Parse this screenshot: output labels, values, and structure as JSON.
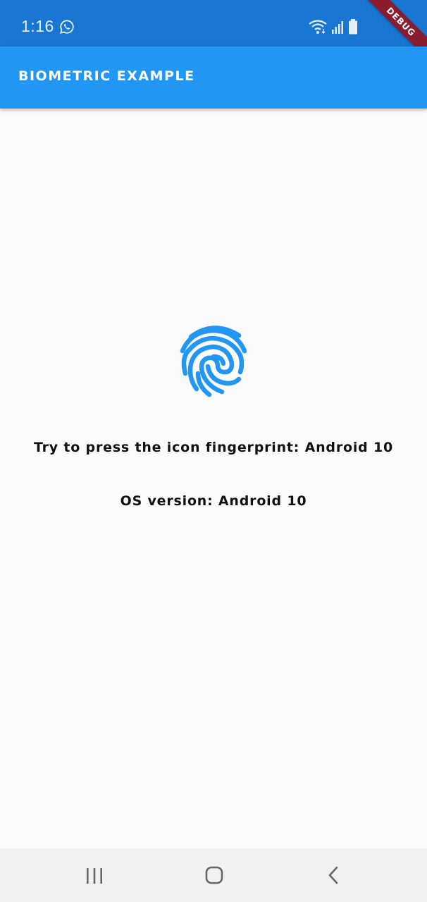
{
  "status_bar": {
    "time": "1:16",
    "icons": [
      "whatsapp-icon",
      "wifi-icon",
      "signal-icon",
      "battery-icon"
    ]
  },
  "debug_banner": {
    "label": "DEBUG"
  },
  "app_bar": {
    "title": "BIOMETRIC EXAMPLE"
  },
  "main": {
    "fingerprint_icon": "fingerprint-icon",
    "prompt": "Try to press the icon fingerprint: Android 10",
    "os_version": "OS version: Android 10"
  },
  "nav_bar": {
    "buttons": [
      "recents-icon",
      "home-icon",
      "back-icon"
    ]
  },
  "colors": {
    "status_bar": "#1976d2",
    "app_bar": "#2196f3",
    "fingerprint": "#2196f3",
    "background": "#fafafa",
    "debug_ribbon": "#8a1c2e"
  }
}
